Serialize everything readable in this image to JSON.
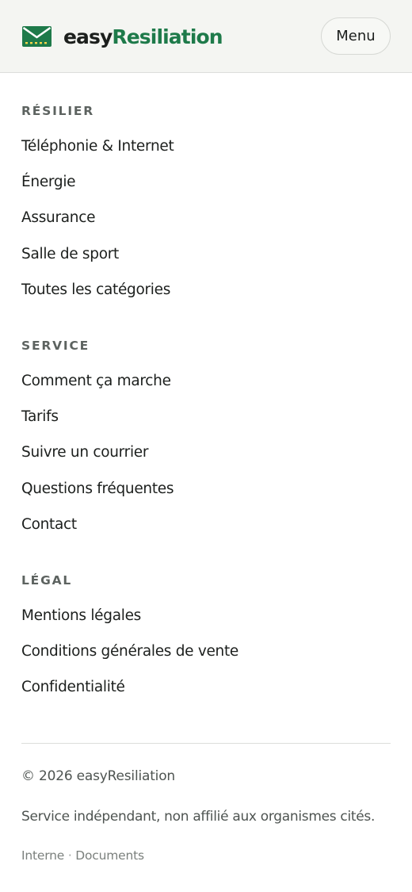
{
  "header": {
    "brand": {
      "part1": "easy",
      "part2": "Resiliation"
    },
    "logo_icon": "envelope-icon",
    "menu_label": "Menu"
  },
  "nav": {
    "sections": [
      {
        "heading": "RÉSILIER",
        "items": [
          "Téléphonie & Internet",
          "Énergie",
          "Assurance",
          "Salle de sport",
          "Toutes les catégories"
        ]
      },
      {
        "heading": "SERVICE",
        "items": [
          "Comment ça marche",
          "Tarifs",
          "Suivre un courrier",
          "Questions fréquentes",
          "Contact"
        ]
      },
      {
        "heading": "LÉGAL",
        "items": [
          "Mentions légales",
          "Conditions générales de vente",
          "Confidentialité"
        ]
      }
    ]
  },
  "footer": {
    "copyright": "© 2026 easyResiliation",
    "disclaimer": "Service indépendant, non affilié aux organismes cités.",
    "links": [
      "Interne",
      "Documents"
    ],
    "separator": "·"
  },
  "colors": {
    "brand_green": "#1e7a4a",
    "header_bg": "#f4f5f2",
    "text": "#1c1f1d",
    "muted": "#5d6360"
  }
}
